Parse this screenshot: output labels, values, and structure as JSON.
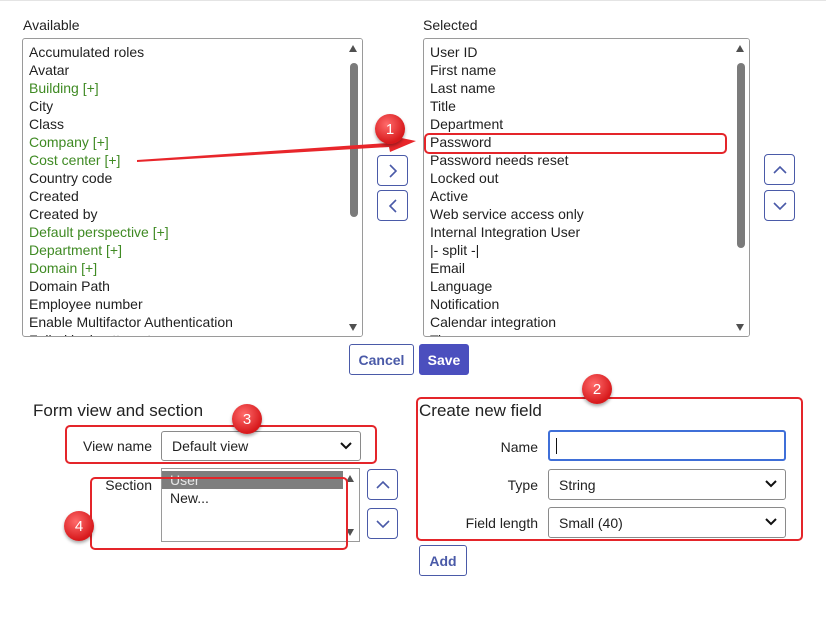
{
  "available": {
    "title": "Available",
    "items": [
      {
        "label": "Accumulated roles",
        "green": false
      },
      {
        "label": "Avatar",
        "green": false
      },
      {
        "label": "Building [+]",
        "green": true
      },
      {
        "label": "City",
        "green": false
      },
      {
        "label": "Class",
        "green": false
      },
      {
        "label": "Company [+]",
        "green": true
      },
      {
        "label": "Cost center [+]",
        "green": true
      },
      {
        "label": "Country code",
        "green": false
      },
      {
        "label": "Created",
        "green": false
      },
      {
        "label": "Created by",
        "green": false
      },
      {
        "label": "Default perspective [+]",
        "green": true
      },
      {
        "label": "Department [+]",
        "green": true
      },
      {
        "label": "Domain [+]",
        "green": true
      },
      {
        "label": "Domain Path",
        "green": false
      },
      {
        "label": "Employee number",
        "green": false
      },
      {
        "label": "Enable Multifactor Authentication",
        "green": false
      },
      {
        "label": "Failed login attempts",
        "green": false
      }
    ]
  },
  "selected": {
    "title": "Selected",
    "items": [
      "User ID",
      "First name",
      "Last name",
      "Title",
      "Department",
      "Password",
      "Password needs reset",
      "Locked out",
      "Active",
      "Web service access only",
      "Internal Integration User",
      "|- split -|",
      "Email",
      "Language",
      "Notification",
      "Calendar integration",
      "Time zone"
    ]
  },
  "buttons": {
    "cancel": "Cancel",
    "save": "Save",
    "add": "Add"
  },
  "form_view": {
    "title": "Form view and section",
    "view_name_label": "View name",
    "view_name_value": "Default view",
    "section_label": "Section",
    "section_items": [
      {
        "label": "User",
        "selected": true
      },
      {
        "label": "New...",
        "selected": false
      }
    ]
  },
  "create_field": {
    "title": "Create new field",
    "name_label": "Name",
    "name_value": "",
    "type_label": "Type",
    "type_value": "String",
    "length_label": "Field length",
    "length_value": "Small (40)"
  },
  "annotations": {
    "b1": "1",
    "b2": "2",
    "b3": "3",
    "b4": "4"
  },
  "colors": {
    "accent": "#4b4fbe",
    "green_item": "#3f8a23",
    "annotation_red": "#e4252a"
  }
}
